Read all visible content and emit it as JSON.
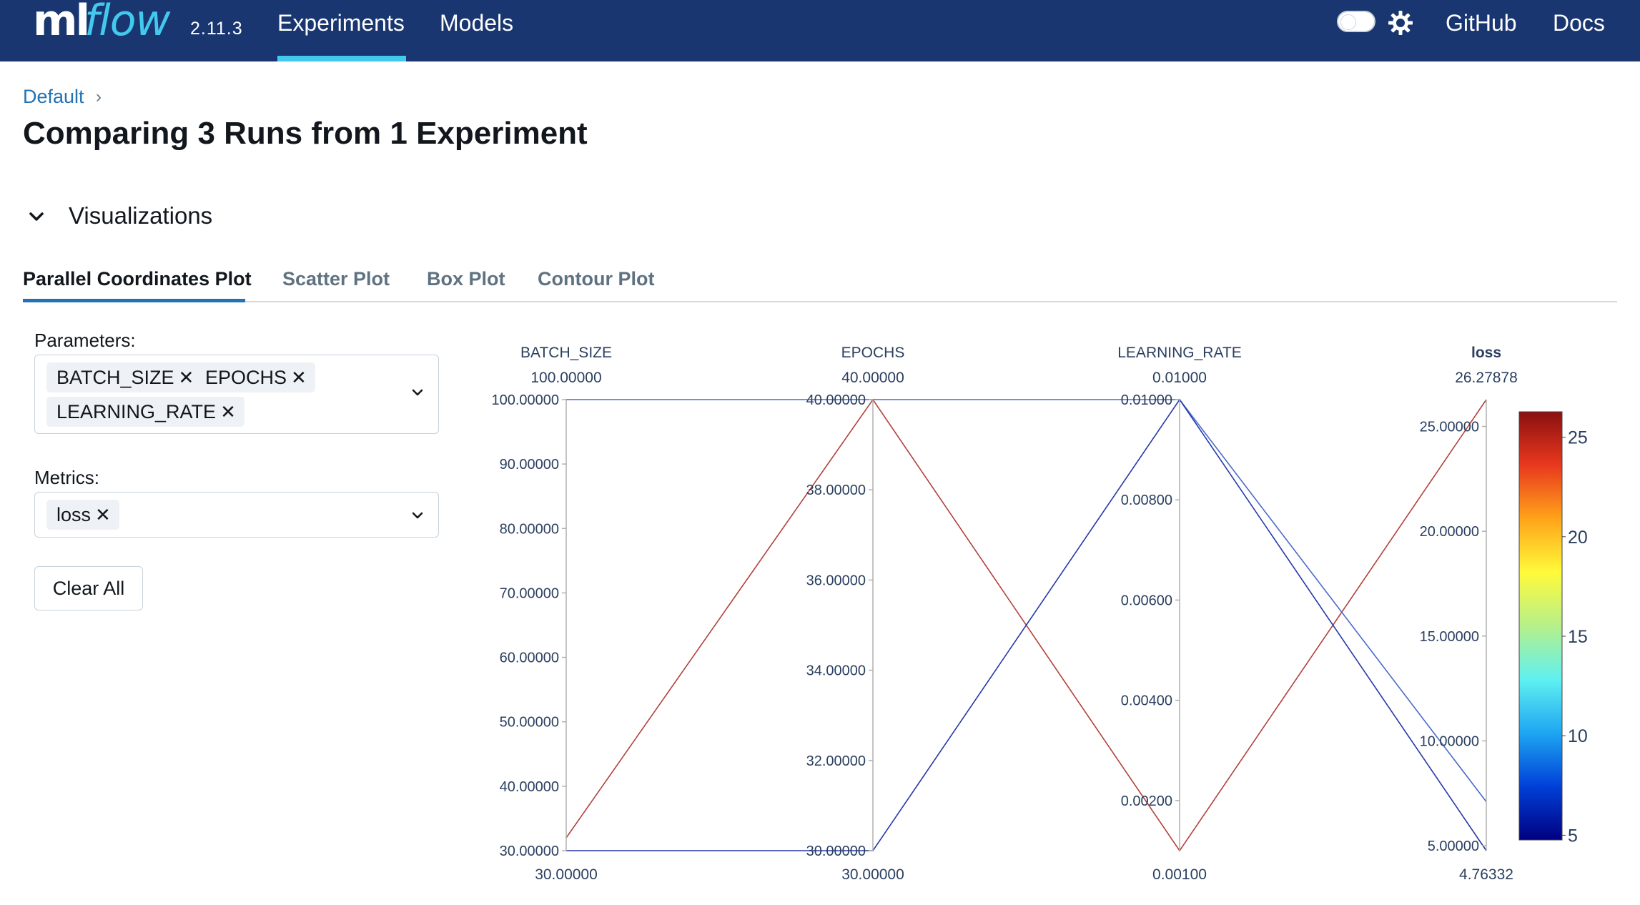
{
  "header": {
    "logo_ml": "ml",
    "logo_flow": "flow",
    "version": "2.11.3",
    "nav": {
      "experiments": "Experiments",
      "models": "Models",
      "github": "GitHub",
      "docs": "Docs"
    },
    "colors": {
      "bar": "#193670",
      "accent": "#43c9ed"
    }
  },
  "breadcrumb": {
    "experiment": "Default",
    "separator": "›"
  },
  "page_title": "Comparing 3 Runs from 1 Experiment",
  "visualizations": {
    "title": "Visualizations",
    "tabs": [
      "Parallel Coordinates Plot",
      "Scatter Plot",
      "Box Plot",
      "Contour Plot"
    ],
    "active_tab": "Parallel Coordinates Plot"
  },
  "controls": {
    "parameters_label": "Parameters:",
    "parameters": [
      "BATCH_SIZE",
      "EPOCHS",
      "LEARNING_RATE"
    ],
    "metrics_label": "Metrics:",
    "metrics": [
      "loss"
    ],
    "clear_label": "Clear All",
    "remove_glyph": "✕"
  },
  "chart_data": {
    "type": "parallel_coordinates",
    "dimensions": [
      {
        "name": "BATCH_SIZE",
        "min": 30,
        "max": 100,
        "min_label": "30.00000",
        "max_label": "100.00000",
        "ticks": [
          30,
          40,
          50,
          60,
          70,
          80,
          90,
          100
        ],
        "tick_labels": [
          "30.00000",
          "40.00000",
          "50.00000",
          "60.00000",
          "70.00000",
          "80.00000",
          "90.00000",
          "100.00000"
        ]
      },
      {
        "name": "EPOCHS",
        "min": 30,
        "max": 40,
        "min_label": "30.00000",
        "max_label": "40.00000",
        "ticks": [
          30,
          32,
          34,
          36,
          38,
          40
        ],
        "tick_labels": [
          "30.00000",
          "32.00000",
          "34.00000",
          "36.00000",
          "38.00000",
          "40.00000"
        ]
      },
      {
        "name": "LEARNING_RATE",
        "min": 0.001,
        "max": 0.01,
        "min_label": "0.00100",
        "max_label": "0.01000",
        "ticks": [
          0.002,
          0.004,
          0.006,
          0.008,
          0.01
        ],
        "tick_labels": [
          "0.00200",
          "0.00400",
          "0.00600",
          "0.00800",
          "0.01000"
        ]
      },
      {
        "name": "loss",
        "min": 4.76332,
        "max": 26.27878,
        "min_label": "4.76332",
        "max_label": "26.27878",
        "ticks": [
          5,
          10,
          15,
          20,
          25
        ],
        "tick_labels": [
          "5.00000",
          "10.00000",
          "15.00000",
          "20.00000",
          "25.00000"
        ],
        "highlight": true
      }
    ],
    "runs": [
      {
        "BATCH_SIZE": 32,
        "EPOCHS": 40,
        "LEARNING_RATE": 0.001,
        "loss": 26.27878,
        "color": "#b2413a"
      },
      {
        "BATCH_SIZE": 100,
        "EPOCHS": 40,
        "LEARNING_RATE": 0.01,
        "loss": 7.1,
        "color": "#4b6ac9"
      },
      {
        "BATCH_SIZE": 30,
        "EPOCHS": 30,
        "LEARNING_RATE": 0.01,
        "loss": 4.76332,
        "color": "#2538a8"
      }
    ],
    "colorbar": {
      "ticks": [
        5,
        10,
        15,
        20,
        25
      ],
      "min": 4.76332,
      "max": 26.27878,
      "colors": [
        "#000080",
        "#0040d8",
        "#1ea6f2",
        "#5ff0f0",
        "#b6f08a",
        "#fffa3a",
        "#ffa41a",
        "#e9381e",
        "#8a1010"
      ]
    },
    "highlight_color": "#2e7d12"
  }
}
